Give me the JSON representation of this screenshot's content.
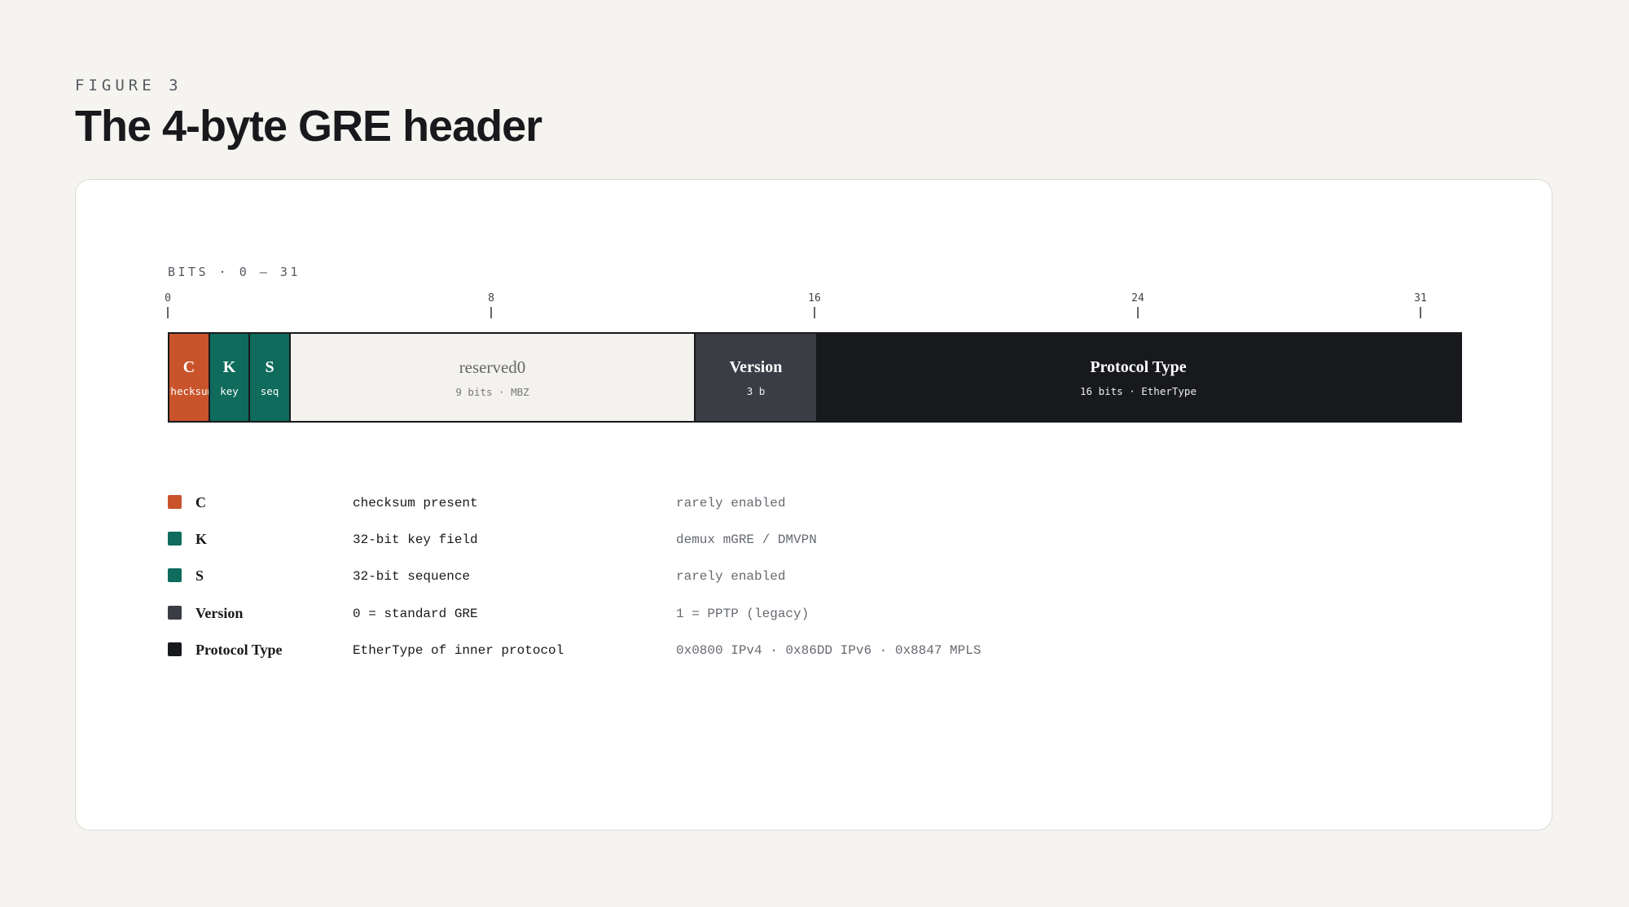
{
  "figure_label": "FIGURE 3",
  "title": "The 4-byte GRE header",
  "diagram": {
    "bits_label": "BITS · 0 — 31",
    "ticks": [
      "0",
      "8",
      "16",
      "24",
      "31"
    ],
    "fields": [
      {
        "name": "C",
        "sub": "checksum",
        "color": "#c9542c"
      },
      {
        "name": "K",
        "sub": "key",
        "color": "#0f6b5c"
      },
      {
        "name": "S",
        "sub": "seq",
        "color": "#0f6b5c"
      },
      {
        "name": "reserved0",
        "sub": "9 bits · MBZ",
        "color": "#f3f2ee"
      },
      {
        "name": "Version",
        "sub": "3 b",
        "color": "#3a3d43"
      },
      {
        "name": "Protocol Type",
        "sub": "16 bits · EtherType",
        "color": "#18191c"
      }
    ]
  },
  "legend": [
    {
      "name": "C",
      "desc": "checksum present",
      "note": "rarely enabled",
      "color": "#c9542c"
    },
    {
      "name": "K",
      "desc": "32-bit key field",
      "note": "demux mGRE / DMVPN",
      "color": "#0f6b5c"
    },
    {
      "name": "S",
      "desc": "32-bit sequence",
      "note": "rarely enabled",
      "color": "#0f6b5c"
    },
    {
      "name": "Version",
      "desc": "0 = standard GRE",
      "note": "1 = PPTP (legacy)",
      "color": "#3a3d43"
    },
    {
      "name": "Protocol Type",
      "desc": "EtherType of inner protocol",
      "note": "0x0800 IPv4 · 0x86DD IPv6 · 0x8847 MPLS",
      "color": "#18191c"
    }
  ]
}
